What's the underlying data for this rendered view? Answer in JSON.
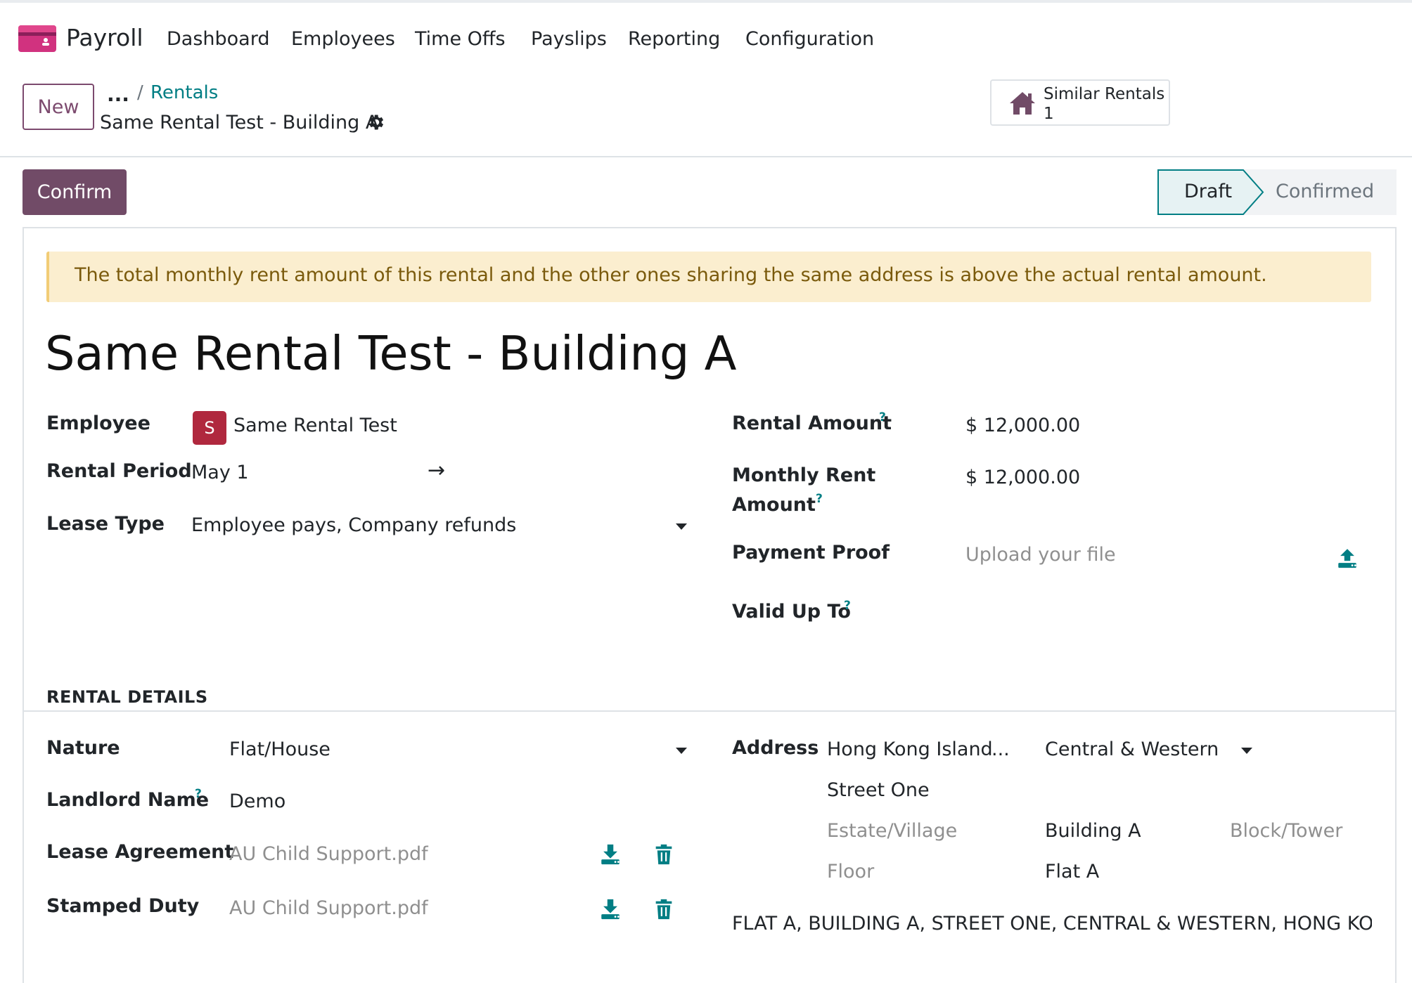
{
  "app": {
    "name": "Payroll",
    "logo_icon": "payroll-logo-icon"
  },
  "menu": [
    "Dashboard",
    "Employees",
    "Time Offs",
    "Payslips",
    "Reporting",
    "Configuration"
  ],
  "control_panel": {
    "new_label": "New",
    "breadcrumb_ellipsis": "...",
    "breadcrumb_sep": "/",
    "breadcrumb_parent": "Rentals",
    "breadcrumb_current": "Same Rental Test - Building A",
    "smart_button": {
      "label": "Similar Rentals",
      "count": "1",
      "icon": "house-icon"
    }
  },
  "statusbar": {
    "confirm_label": "Confirm",
    "stages": [
      "Draft",
      "Confirmed"
    ],
    "active": "Draft"
  },
  "alert": "The total monthly rent amount of this rental and the other ones sharing the same address is above the actual rental amount.",
  "form": {
    "title": "Same Rental Test - Building A",
    "left": {
      "employee_label": "Employee",
      "employee_initial": "S",
      "employee_value": "Same Rental Test",
      "period_label": "Rental Period",
      "period_start": "May 1",
      "period_arrow": "→",
      "lease_type_label": "Lease Type",
      "lease_type_value": "Employee pays, Company refunds"
    },
    "right": {
      "rental_amount_label": "Rental Amount",
      "rental_amount_value": "$ 12,000.00",
      "monthly_rent_label_1": "Monthly Rent",
      "monthly_rent_label_2": "Amount",
      "monthly_rent_value": "$ 12,000.00",
      "payment_proof_label": "Payment Proof",
      "payment_proof_placeholder": "Upload your file",
      "valid_up_to_label": "Valid Up To"
    },
    "help_mark": "?",
    "section_title": "RENTAL DETAILS",
    "details_left": {
      "nature_label": "Nature",
      "nature_value": "Flat/House",
      "landlord_label": "Landlord Name",
      "landlord_value": "Demo",
      "lease_agreement_label": "Lease Agreement",
      "lease_agreement_file": "AU Child Support.pdf",
      "stamped_duty_label": "Stamped Duty",
      "stamped_duty_file": "AU Child Support.pdf"
    },
    "address": {
      "label": "Address",
      "region": "Hong Kong Island",
      "region_more": "...",
      "district": "Central & Western",
      "street": "Street One",
      "estate_placeholder": "Estate/Village",
      "building": "Building A",
      "block_placeholder": "Block/Tower",
      "floor_placeholder": "Floor",
      "flat": "Flat A",
      "full": "FLAT A, BUILDING A, STREET ONE, CENTRAL & WESTERN, HONG KONG IS"
    }
  },
  "colors": {
    "brand": "#714b67",
    "link": "#017e84",
    "alert_bg": "#fbeecf",
    "avatar": "#b0283e"
  }
}
